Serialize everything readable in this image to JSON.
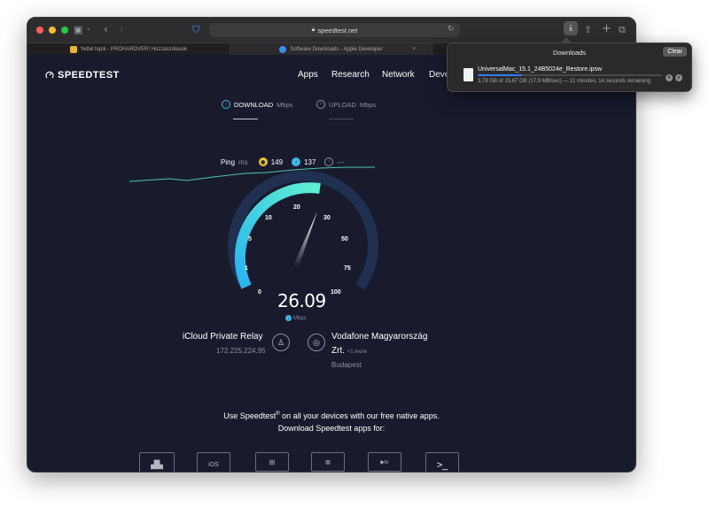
{
  "browser": {
    "url": "speedtest.net",
    "tabs": [
      {
        "title": "Yettel topik - PROHARDVER! Hozzászólások",
        "favicon_color": "#e8b53a"
      },
      {
        "title": "Software Downloads - Apple Developer",
        "favicon_color": "#3a8ef6"
      },
      {
        "title": "",
        "favicon_color": ""
      }
    ]
  },
  "site": {
    "logo": "SPEEDTEST",
    "nav": [
      "Apps",
      "Research",
      "Network",
      "Deve"
    ],
    "download_label": "DOWNLOAD",
    "upload_label": "UPLOAD",
    "unit_mbps": "Mbps",
    "ping_label": "Ping",
    "ping_unit": "ms",
    "ping_idle": "149",
    "ping_download": "137",
    "ping_upload": "—",
    "gauge_ticks": [
      "0",
      "1",
      "5",
      "10",
      "20",
      "30",
      "50",
      "75",
      "100"
    ],
    "speed_value": "26.09",
    "speed_unit": "Mbps",
    "relay_name": "iCloud Private Relay",
    "relay_ip": "172.225.224.95",
    "isp_name_line1": "Vodafone Magyarország",
    "isp_name_line2": "Zrt.",
    "isp_more": "+1 more",
    "isp_city": "Budapest",
    "promo_line1": "Use Speedtest",
    "promo_reg": "®",
    "promo_line1b": " on all your devices with our free native apps.",
    "promo_line2": "Download Speedtest apps for:",
    "ios_label": "iOS"
  },
  "downloads": {
    "title": "Downloads",
    "clear": "Clear",
    "file_name": "UniversalMac_15.1_24B5024e_Restore.ipsw",
    "status": "3,78 GB of 15,67 GB (17,9 MB/sec) — 11 minutes, 14 seconds remaining",
    "progress": 0.241
  },
  "colors": {
    "accent": "#5ff0d0",
    "gauge_blue": "#29b4f0",
    "gauge_track": "#1f3050",
    "download_icon": "#3fb6e8",
    "ping_icon": "#e8c23a"
  }
}
